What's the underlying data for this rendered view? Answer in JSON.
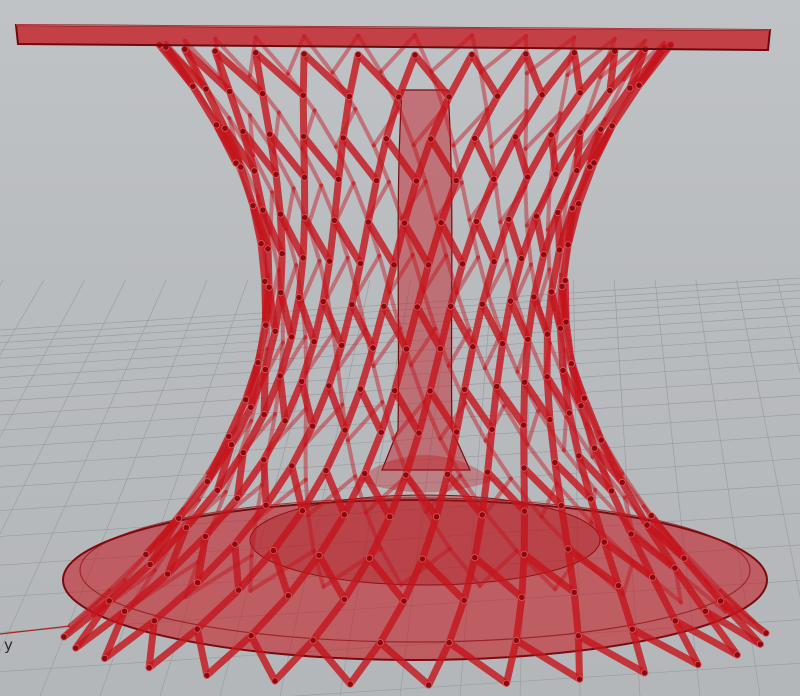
{
  "viewport": {
    "axis_label": "y",
    "model_color": "#c4141c",
    "background_color": "#b9bcbf",
    "grid_color": "#9a9ea2"
  }
}
